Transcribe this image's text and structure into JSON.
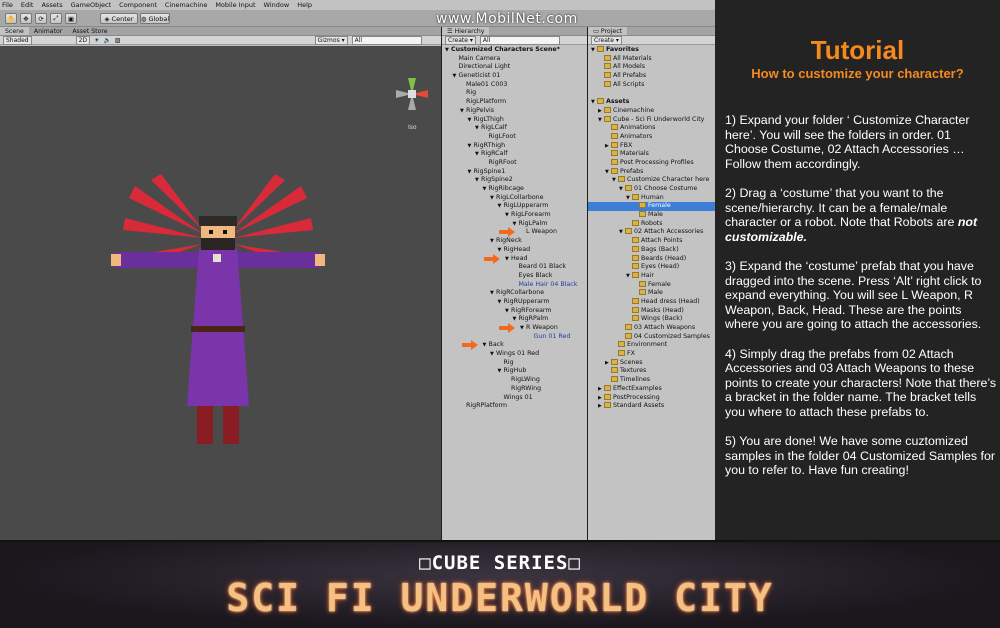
{
  "menu": [
    "File",
    "Edit",
    "Assets",
    "GameObject",
    "Component",
    "Cinemachine",
    "Mobile Input",
    "Window",
    "Help"
  ],
  "toolbar": {
    "pivot": "Center",
    "space": "Global"
  },
  "watermark": "www.MobilNet.com",
  "scene": {
    "tabs": [
      "Scene",
      "Animator",
      "Asset Store"
    ],
    "shading": "Shaded",
    "mode2d": "2D",
    "gizmos": "Gizmos ▾",
    "search_placeholder": "All",
    "iso": "Iso"
  },
  "hierarchy": {
    "tab": "Hierarchy",
    "create": "Create ▾",
    "search_placeholder": "All",
    "rows": [
      {
        "t": "Customized Characters Scene*",
        "d": 0,
        "bold": true,
        "exp": "▼"
      },
      {
        "t": "Main Camera",
        "d": 1
      },
      {
        "t": "Directional Light",
        "d": 1
      },
      {
        "t": "Geneticist 01",
        "d": 1,
        "exp": "▼"
      },
      {
        "t": "Male01 C003",
        "d": 2
      },
      {
        "t": "Rig",
        "d": 2
      },
      {
        "t": "RigLPlatform",
        "d": 2
      },
      {
        "t": "RigPelvis",
        "d": 2,
        "exp": "▼"
      },
      {
        "t": "RigLThigh",
        "d": 3,
        "exp": "▼"
      },
      {
        "t": "RigLCalf",
        "d": 4,
        "exp": "▼"
      },
      {
        "t": "RigLFoot",
        "d": 5
      },
      {
        "t": "RigRThigh",
        "d": 3,
        "exp": "▼"
      },
      {
        "t": "RigRCalf",
        "d": 4,
        "exp": "▼"
      },
      {
        "t": "RigRFoot",
        "d": 5
      },
      {
        "t": "RigSpine1",
        "d": 3,
        "exp": "▼"
      },
      {
        "t": "RigSpine2",
        "d": 4,
        "exp": "▼"
      },
      {
        "t": "RigRibcage",
        "d": 5,
        "exp": "▼"
      },
      {
        "t": "RigLCollarbone",
        "d": 6,
        "exp": "▼"
      },
      {
        "t": "RigLUpperarm",
        "d": 7,
        "exp": "▼"
      },
      {
        "t": "RigLForearm",
        "d": 8,
        "exp": "▼"
      },
      {
        "t": "RigLPalm",
        "d": 9,
        "exp": "▼"
      },
      {
        "t": "L Weapon",
        "d": 10,
        "arrow": true
      },
      {
        "t": "RigNeck",
        "d": 6,
        "exp": "▼"
      },
      {
        "t": "RigHead",
        "d": 7,
        "exp": "▼"
      },
      {
        "t": "Head",
        "d": 8,
        "exp": "▼",
        "arrow": true
      },
      {
        "t": "Beard 01 Black",
        "d": 9
      },
      {
        "t": "Eyes Black",
        "d": 9
      },
      {
        "t": "Male Hair 04 Black",
        "d": 9,
        "blue": true
      },
      {
        "t": "RigRCollarbone",
        "d": 6,
        "exp": "▼"
      },
      {
        "t": "RigRUpperarm",
        "d": 7,
        "exp": "▼"
      },
      {
        "t": "RigRForearm",
        "d": 8,
        "exp": "▼"
      },
      {
        "t": "RigRPalm",
        "d": 9,
        "exp": "▼"
      },
      {
        "t": "R Weapon",
        "d": 10,
        "exp": "▼",
        "arrow": true
      },
      {
        "t": "Gun 01 Red",
        "d": 11,
        "blue": true
      },
      {
        "t": "Back",
        "d": 5,
        "exp": "▼",
        "arrow": true
      },
      {
        "t": "Wings 01 Red",
        "d": 6,
        "exp": "▼"
      },
      {
        "t": "Rig",
        "d": 7
      },
      {
        "t": "RigHub",
        "d": 7,
        "exp": "▼"
      },
      {
        "t": "RigLWing",
        "d": 8
      },
      {
        "t": "RigRWing",
        "d": 8
      },
      {
        "t": "Wings 01",
        "d": 7
      },
      {
        "t": "RigRPlatform",
        "d": 2
      }
    ]
  },
  "project": {
    "tab": "Project",
    "create": "Create ▾",
    "rows": [
      {
        "t": "Favorites",
        "d": 0,
        "exp": "▼",
        "bold": true
      },
      {
        "t": "All Materials",
        "d": 1
      },
      {
        "t": "All Models",
        "d": 1
      },
      {
        "t": "All Prefabs",
        "d": 1
      },
      {
        "t": "All Scripts",
        "d": 1
      },
      {
        "t": "",
        "d": 0
      },
      {
        "t": "Assets",
        "d": 0,
        "exp": "▼",
        "bold": true
      },
      {
        "t": "Cinemachine",
        "d": 1,
        "exp": "▶"
      },
      {
        "t": "Cube - Sci Fi Underworld City",
        "d": 1,
        "exp": "▼"
      },
      {
        "t": "Animations",
        "d": 2
      },
      {
        "t": "Animators",
        "d": 2
      },
      {
        "t": "FBX",
        "d": 2,
        "exp": "▶"
      },
      {
        "t": "Materials",
        "d": 2
      },
      {
        "t": "Post Processing Profiles",
        "d": 2
      },
      {
        "t": "Prefabs",
        "d": 2,
        "exp": "▼"
      },
      {
        "t": "Customize Character here",
        "d": 3,
        "exp": "▼"
      },
      {
        "t": "01 Choose Costume",
        "d": 4,
        "exp": "▼"
      },
      {
        "t": "Human",
        "d": 5,
        "exp": "▼"
      },
      {
        "t": "Female",
        "d": 6,
        "sel": true
      },
      {
        "t": "Male",
        "d": 6
      },
      {
        "t": "Robots",
        "d": 5
      },
      {
        "t": "02 Attach Accessories",
        "d": 4,
        "exp": "▼"
      },
      {
        "t": "Attach Points",
        "d": 5
      },
      {
        "t": "Bags (Back)",
        "d": 5
      },
      {
        "t": "Beards (Head)",
        "d": 5
      },
      {
        "t": "Eyes (Head)",
        "d": 5
      },
      {
        "t": "Hair",
        "d": 5,
        "exp": "▼"
      },
      {
        "t": "Female",
        "d": 6
      },
      {
        "t": "Male",
        "d": 6
      },
      {
        "t": "Head dress (Head)",
        "d": 5
      },
      {
        "t": "Masks (Head)",
        "d": 5
      },
      {
        "t": "Wings (Back)",
        "d": 5
      },
      {
        "t": "03 Attach Weapons",
        "d": 4
      },
      {
        "t": "04 Customized Samples",
        "d": 4
      },
      {
        "t": "Environment",
        "d": 3
      },
      {
        "t": "FX",
        "d": 3
      },
      {
        "t": "Scenes",
        "d": 2,
        "exp": "▶"
      },
      {
        "t": "Textures",
        "d": 2
      },
      {
        "t": "Timelines",
        "d": 2
      },
      {
        "t": "EffectExamples",
        "d": 1,
        "exp": "▶"
      },
      {
        "t": "PostProcessing",
        "d": 1,
        "exp": "▶"
      },
      {
        "t": "Standard Assets",
        "d": 1,
        "exp": "▶"
      }
    ]
  },
  "tutorial": {
    "title": "Tutorial",
    "subtitle": "How to customize your character?",
    "step1": "1) Expand your folder ‘ Customize Character here’. You will see the folders in order. 01 Choose Costume, 02 Attach Accessories …Follow them accordingly.",
    "step2_a": "2) Drag a ‘costume’ that you want to the scene/hierarchy. It can be a female/male character or a robot. Note that Robots are",
    "step2_b": "not customizable.",
    "step3": "3) Expand the ‘costume’ prefab that you have dragged into the scene. Press ‘Alt’ right click to expand everything. You will see L Weapon, R Weapon, Back, Head. These are the points where you are going to attach the accessories.",
    "step4": "4) Simply drag the prefabs from 02 Attach Accessories and 03 Attach Weapons to these points to create your characters! Note that there’s a bracket in the folder name. The bracket tells you where to attach these prefabs to.",
    "step5": "5) You are done! We have some cuztomized samples in the folder 04 Customized Samples for you to refer to. Have fun creating!"
  },
  "banner": {
    "series": "□CUBE SERIES□",
    "title": "SCI FI UNDERWORLD CITY"
  },
  "colors": {
    "accent": "#f58a1f",
    "selection": "#3d7fd6",
    "link_blue": "#1f3fa8"
  }
}
